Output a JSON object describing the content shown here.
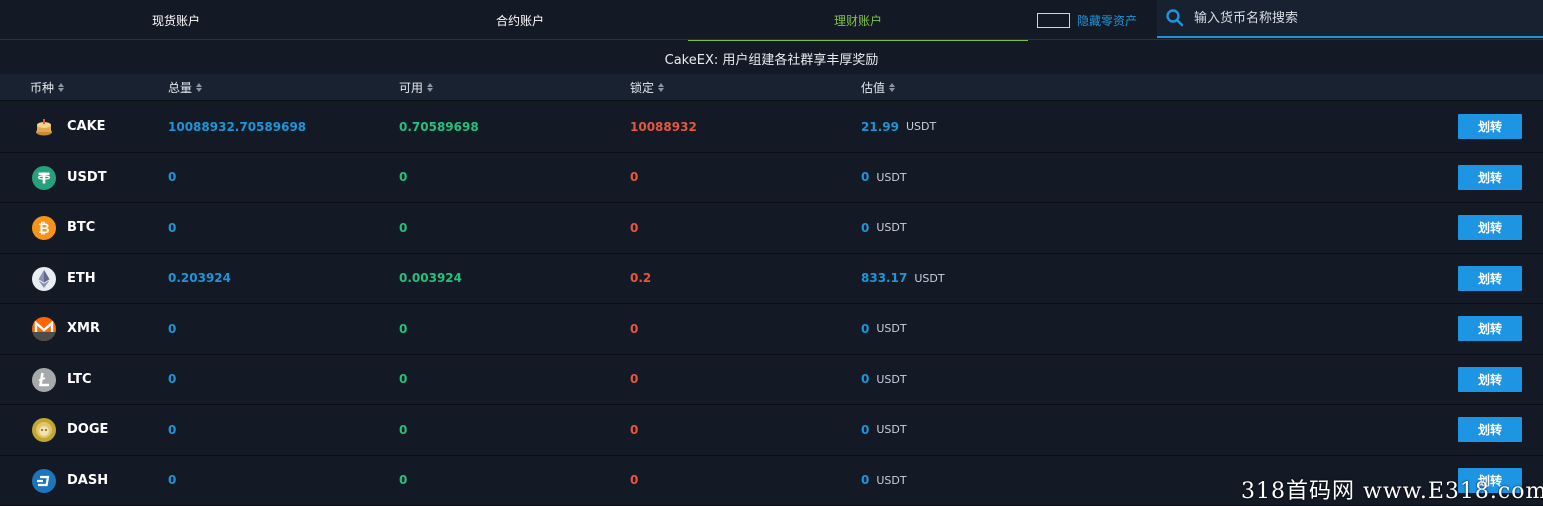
{
  "tabs": [
    {
      "label": "现货账户"
    },
    {
      "label": "合约账户"
    },
    {
      "label": "理财账户"
    }
  ],
  "hide_zero_label": "隐藏零资产",
  "search": {
    "placeholder": "输入货币名称搜索"
  },
  "banner": "CakeEX: 用户组建各社群享丰厚奖励",
  "columns": {
    "coin": "币种",
    "total": "总量",
    "available": "可用",
    "locked": "锁定",
    "value": "估值"
  },
  "transfer_label": "划转",
  "unit": "USDT",
  "rows": [
    {
      "coin": "CAKE",
      "total": "10088932.70589698",
      "available": "0.70589698",
      "locked": "10088932",
      "value": "21.99"
    },
    {
      "coin": "USDT",
      "total": "0",
      "available": "0",
      "locked": "0",
      "value": "0"
    },
    {
      "coin": "BTC",
      "total": "0",
      "available": "0",
      "locked": "0",
      "value": "0"
    },
    {
      "coin": "ETH",
      "total": "0.203924",
      "available": "0.003924",
      "locked": "0.2",
      "value": "833.17"
    },
    {
      "coin": "XMR",
      "total": "0",
      "available": "0",
      "locked": "0",
      "value": "0"
    },
    {
      "coin": "LTC",
      "total": "0",
      "available": "0",
      "locked": "0",
      "value": "0"
    },
    {
      "coin": "DOGE",
      "total": "0",
      "available": "0",
      "locked": "0",
      "value": "0"
    },
    {
      "coin": "DASH",
      "total": "0",
      "available": "0",
      "locked": "0",
      "value": "0"
    }
  ],
  "watermark": "318首码网 www.E318.com",
  "colors": {
    "accent_blue": "#1d95d8",
    "available_green": "#22c27a",
    "locked_red": "#e8553d",
    "active_tab_green": "#7fc243",
    "button_blue": "#1e95e3"
  }
}
